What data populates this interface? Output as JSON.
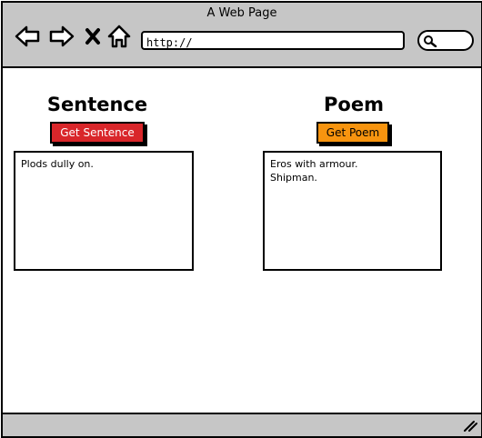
{
  "window": {
    "title": "A Web Page"
  },
  "toolbar": {
    "back_icon": "back-arrow-icon",
    "forward_icon": "forward-arrow-icon",
    "stop_icon": "close-icon",
    "home_icon": "home-icon",
    "address_value": "http://",
    "search_icon": "search-icon"
  },
  "sentence": {
    "heading": "Sentence",
    "button_label": "Get Sentence",
    "button_color": "#d9262a",
    "lines": [
      "Plods dully on."
    ]
  },
  "poem": {
    "heading": "Poem",
    "button_label": "Get Poem",
    "button_color": "#f7940f",
    "lines": [
      "Eros with armour.",
      "Shipman."
    ]
  },
  "statusbar": {
    "grip_icon": "resize-grip-icon"
  }
}
